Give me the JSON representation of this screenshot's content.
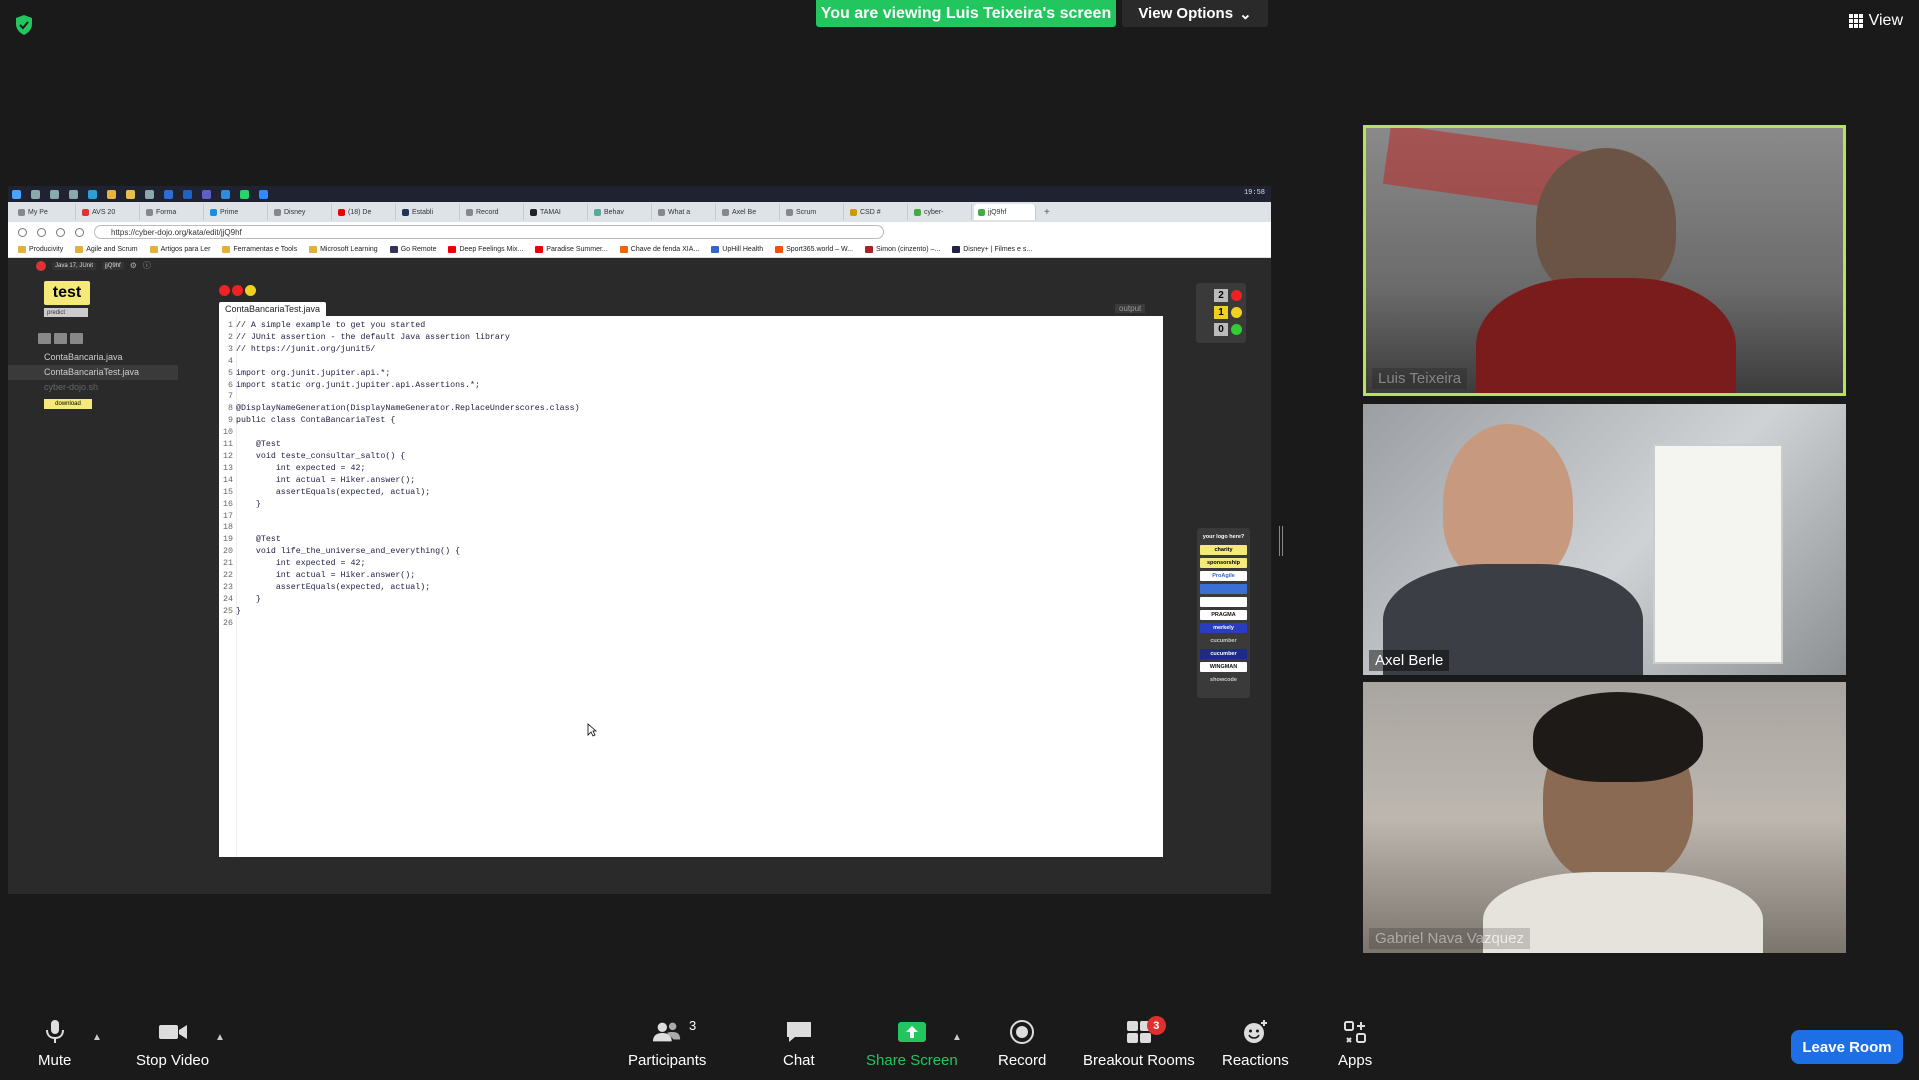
{
  "top": {
    "banner": "You are viewing Luis Teixeira's screen",
    "view_options": "View Options",
    "view": "View"
  },
  "shared_screen": {
    "clock": "19:58",
    "tabs": [
      "My Pe",
      "AVS 20",
      "Forma",
      "Prime",
      "Disney",
      "(18) De",
      "Establi",
      "Record",
      "TAMAI",
      "Behav",
      "What a",
      "Axel Be",
      "Scrum",
      "CSD #",
      "cyber-",
      "jjQ9hf"
    ],
    "url": "https://cyber-dojo.org/kata/edit/jjQ9hf",
    "bookmarks": [
      "Producivity",
      "Agile and Scrum",
      "Artigos para Ler",
      "Ferramentas e Tools",
      "Microsoft Learning",
      "Go Remote",
      "Deep Feelings Mix...",
      "Paradise Summer...",
      "Chave de fenda XIA...",
      "UpHill Health",
      "Sport365.world – W...",
      "Simon (cinzento) –...",
      "Disney+ | Filmes e s..."
    ],
    "dojo_info": [
      "Java 17, JUnit",
      "jjQ9hf"
    ],
    "test_button": "test",
    "predict": "predict",
    "files": [
      "ContaBancaria.java",
      "ContaBancariaTest.java",
      "cyber-dojo.sh"
    ],
    "download": "download",
    "file_tab": "ContaBancariaTest.java",
    "output_label": "output",
    "counts": {
      "red": "2",
      "amber": "1",
      "green": "0"
    },
    "sponsors": [
      "your logo here?",
      "charity",
      "sponsorship",
      "ProAgile",
      "",
      "",
      "PRAGMA",
      "merkely",
      "cucumber",
      "cucumber",
      "WINGMAN",
      "showcode"
    ],
    "code_lines": [
      {
        "n": "1",
        "t": "// A simple example to get you started"
      },
      {
        "n": "2",
        "t": "// JUnit assertion - the default Java assertion library"
      },
      {
        "n": "3",
        "t": "// https://junit.org/junit5/"
      },
      {
        "n": "4",
        "t": ""
      },
      {
        "n": "5",
        "t": "import org.junit.jupiter.api.*;"
      },
      {
        "n": "6",
        "t": "import static org.junit.jupiter.api.Assertions.*;"
      },
      {
        "n": "7",
        "t": ""
      },
      {
        "n": "8",
        "t": "@DisplayNameGeneration(DisplayNameGenerator.ReplaceUnderscores.class)"
      },
      {
        "n": "9",
        "t": "public class ContaBancariaTest {"
      },
      {
        "n": "10",
        "t": ""
      },
      {
        "n": "11",
        "t": "    @Test"
      },
      {
        "n": "12",
        "t": "    void teste_consultar_salto() {"
      },
      {
        "n": "13",
        "t": "        int expected = 42;"
      },
      {
        "n": "14",
        "t": "        int actual = Hiker.answer();"
      },
      {
        "n": "15",
        "t": "        assertEquals(expected, actual);"
      },
      {
        "n": "16",
        "t": "    }"
      },
      {
        "n": "17",
        "t": ""
      },
      {
        "n": "18",
        "t": ""
      },
      {
        "n": "19",
        "t": "    @Test"
      },
      {
        "n": "20",
        "t": "    void life_the_universe_and_everything() {"
      },
      {
        "n": "21",
        "t": "        int expected = 42;"
      },
      {
        "n": "22",
        "t": "        int actual = Hiker.answer();"
      },
      {
        "n": "23",
        "t": "        assertEquals(expected, actual);"
      },
      {
        "n": "24",
        "t": "    }"
      },
      {
        "n": "25",
        "t": "}"
      },
      {
        "n": "26",
        "t": ""
      }
    ]
  },
  "participants": [
    {
      "name": "Luis Teixeira"
    },
    {
      "name": "Axel Berle"
    },
    {
      "name": "Gabriel Nava Vazquez"
    }
  ],
  "toolbar": {
    "mute": "Mute",
    "stop_video": "Stop Video",
    "participants": "Participants",
    "participants_count": "3",
    "chat": "Chat",
    "share_screen": "Share Screen",
    "record": "Record",
    "breakout_rooms": "Breakout Rooms",
    "breakout_badge": "3",
    "reactions": "Reactions",
    "apps": "Apps",
    "leave_room": "Leave Room"
  },
  "colors": {
    "banner": "#23c55e",
    "active_speaker_border": "#b6e35a",
    "leave_button": "#1e6fe6",
    "badge": "#e0302e"
  }
}
